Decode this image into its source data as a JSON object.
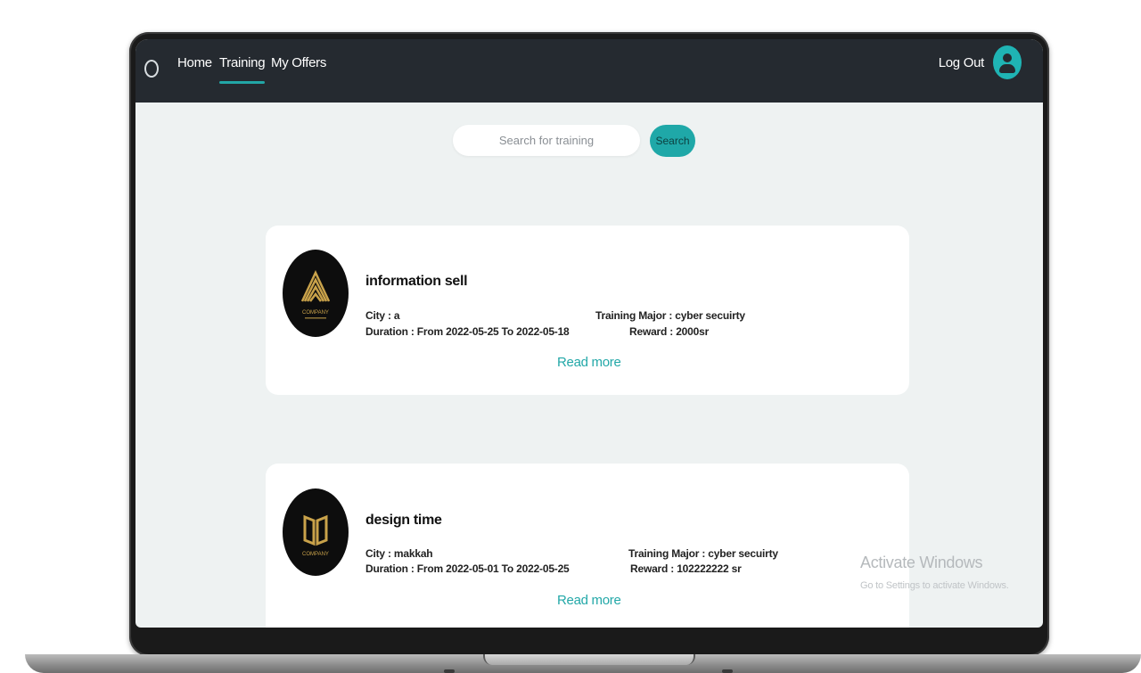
{
  "nav": {
    "links": [
      "Home",
      "Training",
      "My Offers"
    ],
    "active": "Training",
    "logout_label": "Log Out"
  },
  "search": {
    "placeholder": "Search for training",
    "button_label": "Search"
  },
  "trainings": [
    {
      "title": "information sell",
      "city": "City : a",
      "duration": "Duration : From  2022-05-25  To  2022-05-18",
      "major": "Training Major : cyber secuirty",
      "reward": "Reward : 2000sr",
      "read_more": "Read more"
    },
    {
      "title": "design time",
      "city": "City : makkah",
      "duration": "Duration : From  2022-05-01  To  2022-05-25",
      "major": "Training Major : cyber secuirty",
      "reward": "Reward : 102222222 sr",
      "read_more": "Read more"
    }
  ],
  "logos": [
    "COMPANY",
    "COMPANY"
  ],
  "watermark": {
    "title": "Activate Windows",
    "subtitle": "Go to Settings to activate Windows."
  },
  "colors": {
    "navbar": "#252a30",
    "accent": "#1fa8a8",
    "page_bg": "#eef2f2"
  }
}
